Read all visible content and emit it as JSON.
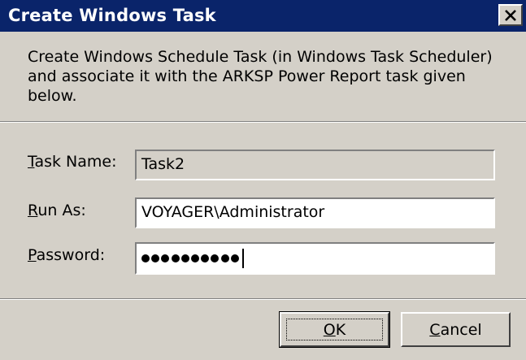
{
  "window": {
    "title": "Create Windows Task",
    "close_icon": "close-icon"
  },
  "description": "Create Windows Schedule Task (in Windows Task Scheduler) and associate it with the ARKSP Power Report task given below.",
  "fields": {
    "task_name": {
      "label_access": "T",
      "label_rest": "ask Name:",
      "value": "Task2"
    },
    "run_as": {
      "label_access": "R",
      "label_rest": "un As:",
      "value": "VOYAGER\\Administrator"
    },
    "password": {
      "label_access": "P",
      "label_rest": "assword:",
      "masked_length": 10
    }
  },
  "buttons": {
    "ok": {
      "access": "O",
      "rest": "K"
    },
    "cancel": {
      "access": "C",
      "rest": "ancel"
    }
  }
}
